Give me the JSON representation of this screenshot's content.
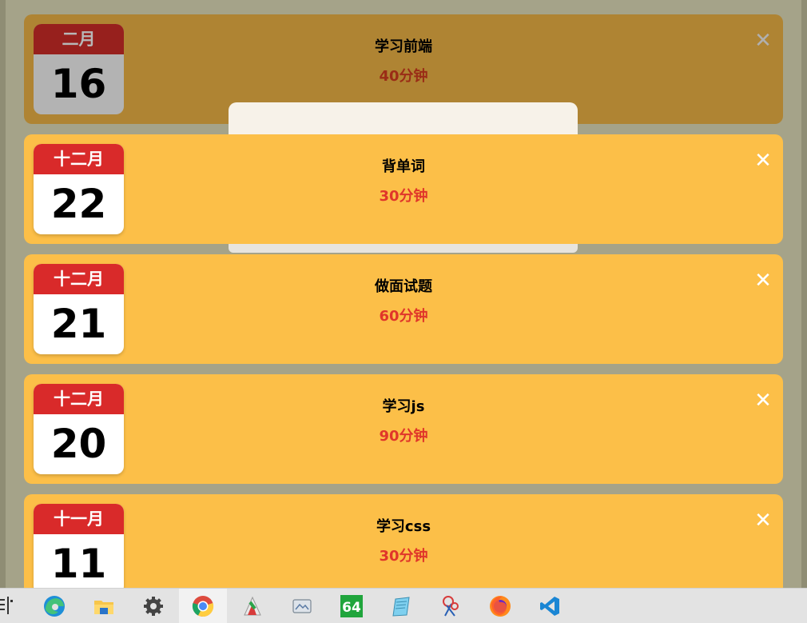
{
  "items": [
    {
      "month": "二月",
      "day": "16",
      "title": "学习前端",
      "duration": "40分钟",
      "close": "✕"
    },
    {
      "month": "十二月",
      "day": "22",
      "title": "背单词",
      "duration": "30分钟",
      "close": "✕"
    },
    {
      "month": "十二月",
      "day": "21",
      "title": "做面试题",
      "duration": "60分钟",
      "close": "✕"
    },
    {
      "month": "十二月",
      "day": "20",
      "title": "学习js",
      "duration": "90分钟",
      "close": "✕"
    },
    {
      "month": "十一月",
      "day": "11",
      "title": "学习css",
      "duration": "30分钟",
      "close": "✕"
    }
  ],
  "taskbar": {
    "apps": [
      "edge-icon",
      "file-explorer-icon",
      "settings-icon",
      "chrome-icon",
      "winrar-icon",
      "screenshot-tool-icon",
      "aida64-icon",
      "notepad-icon",
      "snipping-tool-icon",
      "firefox-icon",
      "vscode-icon"
    ],
    "aida_label": "64"
  },
  "colors": {
    "card": "#fcbf48",
    "card_dimmed": "#af8433",
    "calendar_header": "#d92a2a",
    "duration_text": "#e0362a",
    "popup": "#f7f2e9"
  }
}
